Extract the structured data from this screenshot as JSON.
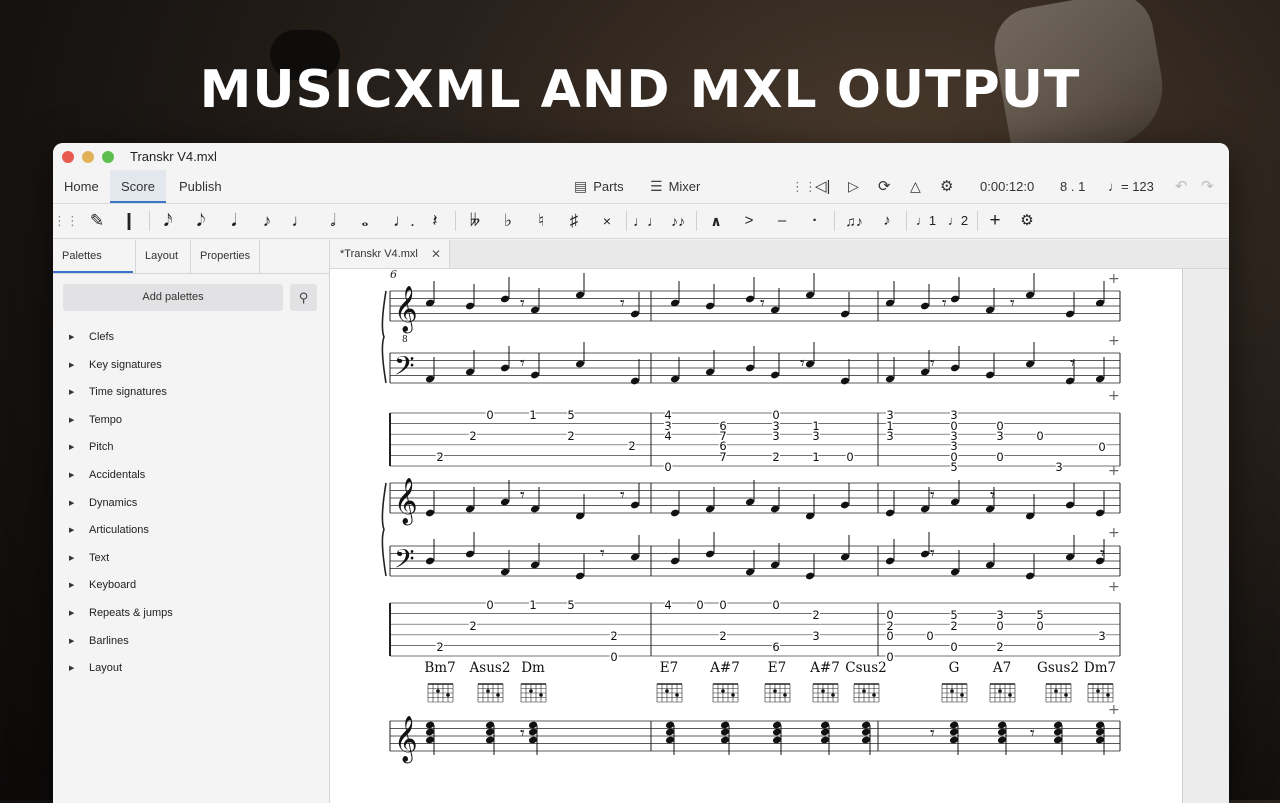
{
  "headline": "MUSICXML AND MXL OUTPUT",
  "window": {
    "title": "Transkr V4.mxl"
  },
  "menu": {
    "tabs": [
      "Home",
      "Score",
      "Publish"
    ],
    "active_tab": "Score",
    "parts_label": "Parts",
    "mixer_label": "Mixer",
    "time": "0:00:12:0",
    "position": "8 . 1",
    "tempo": "= 123"
  },
  "toolbar": {
    "icons": [
      "drag-handle-icon",
      "pencil-icon",
      "input-mode-icon",
      "sixty-fourth-note-icon",
      "thirty-second-note-icon",
      "sixteenth-note-icon",
      "eighth-note-icon",
      "quarter-note-icon",
      "half-note-icon",
      "whole-note-icon",
      "dotted-note-icon",
      "rest-icon",
      "double-flat-icon",
      "flat-icon",
      "natural-icon",
      "sharp-icon",
      "double-sharp-icon",
      "tie-icon",
      "slur-icon",
      "marcato-icon",
      "accent-icon",
      "tenuto-icon",
      "staccato-icon",
      "tuplet-icon",
      "flip-icon",
      "voice-1-icon",
      "voice-2-icon",
      "add-icon",
      "customize-icon"
    ]
  },
  "panel": {
    "tabs": [
      "Palettes",
      "Layout",
      "Properties"
    ],
    "active_tab": "Palettes",
    "add_palettes_label": "Add palettes",
    "items": [
      "Clefs",
      "Key signatures",
      "Time signatures",
      "Tempo",
      "Pitch",
      "Accidentals",
      "Dynamics",
      "Articulations",
      "Text",
      "Keyboard",
      "Repeats & jumps",
      "Barlines",
      "Layout"
    ]
  },
  "document": {
    "tab_label": "*Transkr V4.mxl",
    "measure_number": "6",
    "tab_rows": [
      {
        "numbers": [
          "0",
          "1",
          "5",
          "2",
          "2",
          "2",
          "2",
          "4",
          "3",
          "4",
          "6",
          "7",
          "6",
          "7",
          "0",
          "0",
          "3",
          "3",
          "2",
          "1",
          "3",
          "1",
          "0",
          "1",
          "3",
          "0",
          "3",
          "0",
          "3",
          "0",
          "0",
          "5",
          "0",
          "3",
          "0",
          "3",
          "3",
          "3"
        ]
      },
      {
        "numbers": [
          "0",
          "1",
          "5",
          "2",
          "2",
          "2",
          "0",
          "4",
          "0",
          "0",
          "0",
          "2",
          "2",
          "6",
          "3",
          "0",
          "2",
          "5",
          "3",
          "5",
          "0",
          "2",
          "0",
          "0",
          "3",
          "0",
          "2",
          "0",
          "0"
        ]
      }
    ],
    "chords": [
      "Bm7",
      "Asus2",
      "Dm",
      "E7",
      "A#7",
      "E7",
      "A#7",
      "Csus2",
      "G",
      "A7",
      "Gsus2",
      "Dm7"
    ]
  },
  "colors": {
    "accent": "#3b74c9",
    "tab_active_bg": "#e3e8ef"
  }
}
